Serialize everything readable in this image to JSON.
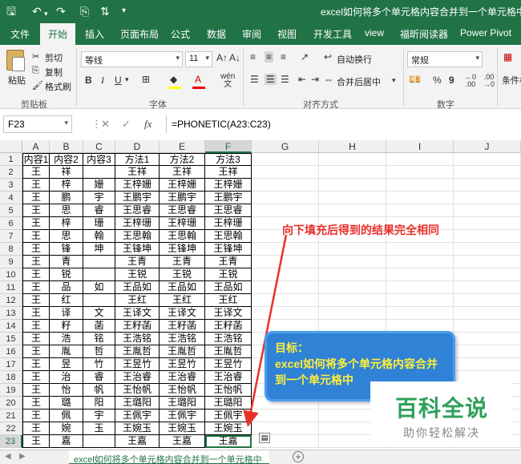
{
  "titlebar": {
    "title": "excel如何将多个单元格内容合并到一个单元格中.x",
    "save_icon": "save-icon",
    "undo_icon": "undo-icon",
    "redo_icon": "redo-icon"
  },
  "tabs": [
    "文件",
    "开始",
    "插入",
    "页面布局",
    "公式",
    "数据",
    "审阅",
    "视图",
    "开发工具",
    "view",
    "福昕阅读器",
    "Power Pivot"
  ],
  "ribbon": {
    "clipboard": {
      "paste": "粘贴",
      "cut": "剪切",
      "copy": "复制",
      "format_painter": "格式刷",
      "group": "剪贴板"
    },
    "font": {
      "name": "等线",
      "size": "11",
      "bold": "B",
      "italic": "I",
      "underline": "U",
      "group": "字体"
    },
    "alignment": {
      "wrap": "自动换行",
      "merge": "合并后居中",
      "group": "对齐方式"
    },
    "number": {
      "format": "常规",
      "percent": "%",
      "comma": "9",
      "group": "数字"
    },
    "styles": {
      "conditional": "条件格"
    }
  },
  "formula_bar": {
    "name_box": "F23",
    "formula": "=PHONETIC(A23:C23)"
  },
  "columns": [
    "A",
    "B",
    "C",
    "D",
    "E",
    "F",
    "G",
    "H",
    "I",
    "J"
  ],
  "rows": [
    [
      "内容1",
      "内容2",
      "内容3",
      "方法1",
      "方法2",
      "方法3"
    ],
    [
      "王",
      "祥",
      "",
      "王祥",
      "王祥",
      "王祥"
    ],
    [
      "王",
      "梓",
      "姗",
      "王梓姗",
      "王梓姗",
      "王梓姗"
    ],
    [
      "王",
      "鹏",
      "宇",
      "王鹏宇",
      "王鹏宇",
      "王鹏宇"
    ],
    [
      "王",
      "思",
      "睿",
      "王思睿",
      "王思睿",
      "王思睿"
    ],
    [
      "王",
      "梓",
      "珊",
      "王梓珊",
      "王梓珊",
      "王梓珊"
    ],
    [
      "王",
      "思",
      "翰",
      "王思翰",
      "王思翰",
      "王思翰"
    ],
    [
      "王",
      "锋",
      "坤",
      "王锋坤",
      "王锋坤",
      "王锋坤"
    ],
    [
      "王",
      "青",
      "",
      "王青",
      "王青",
      "王青"
    ],
    [
      "王",
      "锐",
      "",
      "王锐",
      "王锐",
      "王锐"
    ],
    [
      "王",
      "品",
      "如",
      "王品如",
      "王品如",
      "王品如"
    ],
    [
      "王",
      "红",
      "",
      "王红",
      "王红",
      "王红"
    ],
    [
      "王",
      "译",
      "文",
      "王译文",
      "王译文",
      "王译文"
    ],
    [
      "王",
      "籽",
      "菡",
      "王籽菡",
      "王籽菡",
      "王籽菡"
    ],
    [
      "王",
      "浩",
      "铭",
      "王浩铭",
      "王浩铭",
      "王浩铭"
    ],
    [
      "王",
      "胤",
      "哲",
      "王胤哲",
      "王胤哲",
      "王胤哲"
    ],
    [
      "王",
      "昱",
      "竹",
      "王昱竹",
      "王昱竹",
      "王昱竹"
    ],
    [
      "王",
      "治",
      "睿",
      "王治睿",
      "王治睿",
      "王治睿"
    ],
    [
      "王",
      "怡",
      "帆",
      "王怡帆",
      "王怡帆",
      "王怡帆"
    ],
    [
      "王",
      "璐",
      "阳",
      "王璐阳",
      "王璐阳",
      "王璐阳"
    ],
    [
      "王",
      "佩",
      "宇",
      "王佩宇",
      "王佩宇",
      "王佩宇"
    ],
    [
      "王",
      "婉",
      "玉",
      "王婉玉",
      "王婉玉",
      "王婉玉"
    ],
    [
      "王",
      "嘉",
      "",
      "王嘉",
      "王嘉",
      "王嘉"
    ]
  ],
  "annotations": {
    "red_note": "向下填充后得到的结果完全相同",
    "goal_title": "目标：",
    "goal_text": "excel如何将多个单元格内容合并到一个单元格中",
    "watermark_title": "百科全说",
    "watermark_sub": "助你轻松解决"
  },
  "sheet_tab": "excel如何将多个单元格内容合并到一个单元格中",
  "colors": {
    "accent": "#217346",
    "red": "#e8302a",
    "goal_bg": "#2f82d6",
    "goal_text": "#ffef3a",
    "watermark": "#2ea05a"
  }
}
